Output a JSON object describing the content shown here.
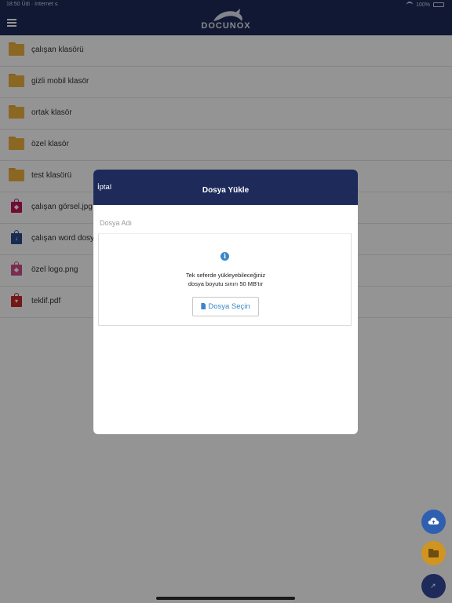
{
  "status_bar": {
    "left_text": "18:50 Üdi · Internet ≤",
    "right_text": "100%"
  },
  "app": {
    "logo_text": "DOCUNOX"
  },
  "files": [
    {
      "name": "çalışan klasörü",
      "type": "folder"
    },
    {
      "name": "gizli mobil klasör",
      "type": "folder"
    },
    {
      "name": "ortak klasör",
      "type": "folder"
    },
    {
      "name": "özel klasör",
      "type": "folder"
    },
    {
      "name": "test klasörü",
      "type": "folder"
    },
    {
      "name": "çalışan görsel.jpg",
      "type": "image",
      "color": "#c2185b"
    },
    {
      "name": "çalışan word dosya",
      "type": "word",
      "color": "#2b4a8c"
    },
    {
      "name": "özel logo.png",
      "type": "image",
      "color": "#d04f8a"
    },
    {
      "name": "teklif.pdf",
      "type": "pdf",
      "color": "#c62828"
    }
  ],
  "modal": {
    "cancel_label": "İptal",
    "title": "Dosya Yükle",
    "name_placeholder": "Dosya Adı",
    "info_line_1": "Tek seferde yükleyebileceğiniz",
    "info_line_2": "dosya boyutu sınırı 50 MB'tır",
    "select_file_label": "Dosya Seçin"
  },
  "colors": {
    "header": "#1e2a5a",
    "folder": "#f0b23f",
    "accent": "#3a86c8",
    "fab_upload": "#2f5fb0",
    "fab_folder": "#d09520"
  },
  "icons": {
    "menu": "menu-icon",
    "info": "info-icon",
    "upload_fab": "cloud-upload-icon",
    "folder_fab": "folder-icon",
    "expand_fab": "expand-icon"
  }
}
